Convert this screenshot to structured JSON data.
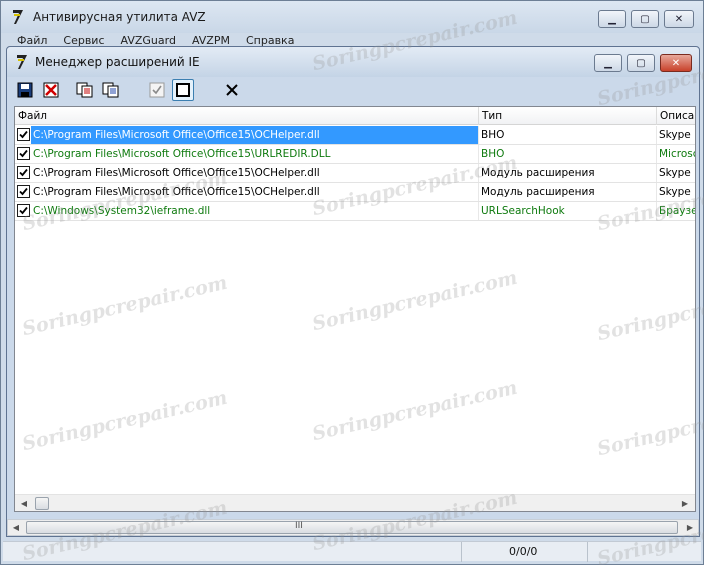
{
  "outer_window": {
    "title": "Антивирусная утилита AVZ",
    "menu": [
      "Файл",
      "Сервис",
      "AVZGuard",
      "AVZPM",
      "Справка"
    ],
    "status": "0/0/0"
  },
  "inner_window": {
    "title": "Менеджер расширений IE",
    "toolbar": [
      {
        "name": "save-icon"
      },
      {
        "name": "delete-red-icon"
      },
      {
        "name": "copy-icon"
      },
      {
        "name": "copy-alt-icon"
      },
      {
        "name": "check-all-icon"
      },
      {
        "name": "uncheck-all-icon"
      },
      {
        "name": "close-x-icon"
      }
    ],
    "columns": [
      "Файл",
      "Тип",
      "Описан"
    ],
    "rows": [
      {
        "file": "C:\\Program Files\\Microsoft Office\\Office15\\OCHelper.dll",
        "type": "BHO",
        "desc": "Skype I",
        "checked": true,
        "color": "black",
        "selected": true
      },
      {
        "file": "C:\\Program Files\\Microsoft Office\\Office15\\URLREDIR.DLL",
        "type": "BHO",
        "desc": "Microsc",
        "checked": true,
        "color": "green",
        "selected": false
      },
      {
        "file": "C:\\Program Files\\Microsoft Office\\Office15\\OCHelper.dll",
        "type": "Модуль расширения",
        "desc": "Skype I",
        "checked": true,
        "color": "black",
        "selected": false
      },
      {
        "file": "C:\\Program Files\\Microsoft Office\\Office15\\OCHelper.dll",
        "type": "Модуль расширения",
        "desc": "Skype I",
        "checked": true,
        "color": "black",
        "selected": false
      },
      {
        "file": "C:\\Windows\\System32\\ieframe.dll",
        "type": "URLSearchHook",
        "desc": "Браузе",
        "checked": true,
        "color": "green",
        "selected": false
      }
    ]
  },
  "watermark": "Soringpcrepair.com",
  "colors": {
    "selection": "#3399ff",
    "green_text": "#0e7a0e"
  }
}
